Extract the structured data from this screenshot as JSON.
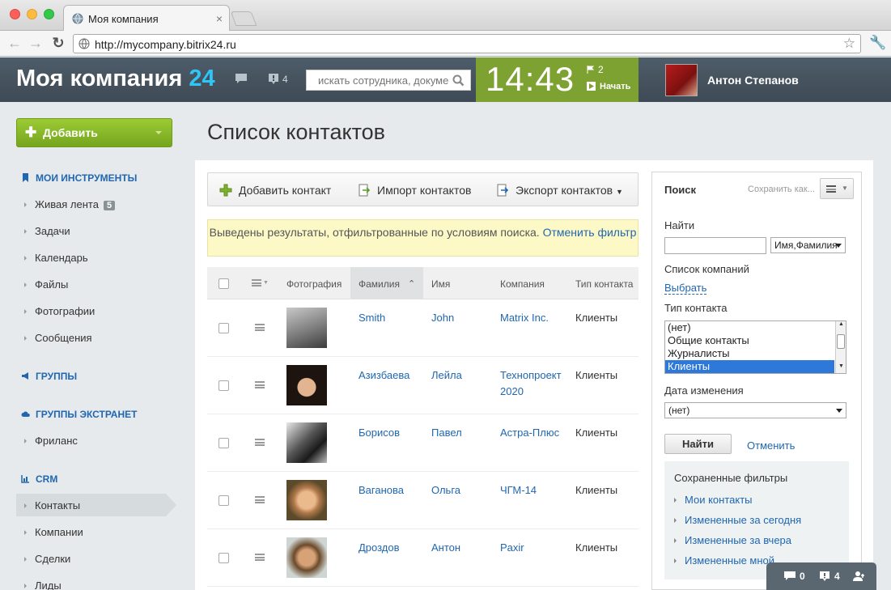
{
  "browser": {
    "tab_title": "Моя компания",
    "url": "http://mycompany.bitrix24.ru"
  },
  "header": {
    "logo_text": "Моя компания",
    "logo_num": "24",
    "notif_count": "4",
    "search_placeholder": "искать сотрудника, документ",
    "clock": "14:43",
    "flag_count": "2",
    "start_label": "Начать",
    "user_name": "Антон Степанов"
  },
  "sidebar": {
    "add_label": "Добавить",
    "sections": {
      "tools": "МОИ ИНСТРУМЕНТЫ",
      "groups": "ГРУППЫ",
      "extranet": "ГРУППЫ ЭКСТРАНЕТ",
      "crm": "CRM"
    },
    "tools_items": [
      "Живая лента",
      "Задачи",
      "Календарь",
      "Файлы",
      "Фотографии",
      "Сообщения"
    ],
    "feed_badge": "5",
    "extranet_items": [
      "Фриланс"
    ],
    "crm_items": [
      "Контакты",
      "Компании",
      "Сделки",
      "Лиды"
    ]
  },
  "main": {
    "title": "Список контактов",
    "toolbar": {
      "add": "Добавить контакт",
      "import": "Импорт контактов",
      "export": "Экспорт контактов"
    },
    "filter_note": "Выведены результаты, отфильтрованные по условиям поиска.",
    "filter_cancel": "Отменить фильтр",
    "columns": [
      "Фотография",
      "Фамилия",
      "Имя",
      "Компания",
      "Тип контакта"
    ],
    "rows": [
      {
        "last": "Smith",
        "first": "John",
        "company": "Matrix Inc.",
        "company2": "",
        "type": "Клиенты"
      },
      {
        "last": "Азизбаева",
        "first": "Лейла",
        "company": "Технопроект",
        "company2": "2020",
        "type": "Клиенты"
      },
      {
        "last": "Борисов",
        "first": "Павел",
        "company": "Астра-Плюс",
        "company2": "",
        "type": "Клиенты"
      },
      {
        "last": "Ваганова",
        "first": "Ольга",
        "company": "ЧГМ-14",
        "company2": "",
        "type": "Клиенты"
      },
      {
        "last": "Дроздов",
        "first": "Антон",
        "company": "Paxir",
        "company2": "",
        "type": "Клиенты"
      }
    ]
  },
  "search_panel": {
    "title": "Поиск",
    "save_as": "Сохранить как...",
    "find_label": "Найти",
    "find_value": "",
    "name_select": "Имя,Фамилия",
    "companies_label": "Список компаний",
    "choose_link": "Выбрать",
    "type_label": "Тип контакта",
    "type_options": [
      "(нет)",
      "Общие контакты",
      "Журналисты",
      "Клиенты"
    ],
    "type_selected": "Клиенты",
    "date_label": "Дата изменения",
    "date_value": "(нет)",
    "find_button": "Найти",
    "cancel_link": "Отменить",
    "saved_title": "Сохраненные фильтры",
    "saved_items": [
      "Мои контакты",
      "Измененные за сегодня",
      "Измененные за вчера",
      "Измененные мной"
    ]
  },
  "bottom_bar": {
    "chat_count": "0",
    "notif_count": "4"
  }
}
